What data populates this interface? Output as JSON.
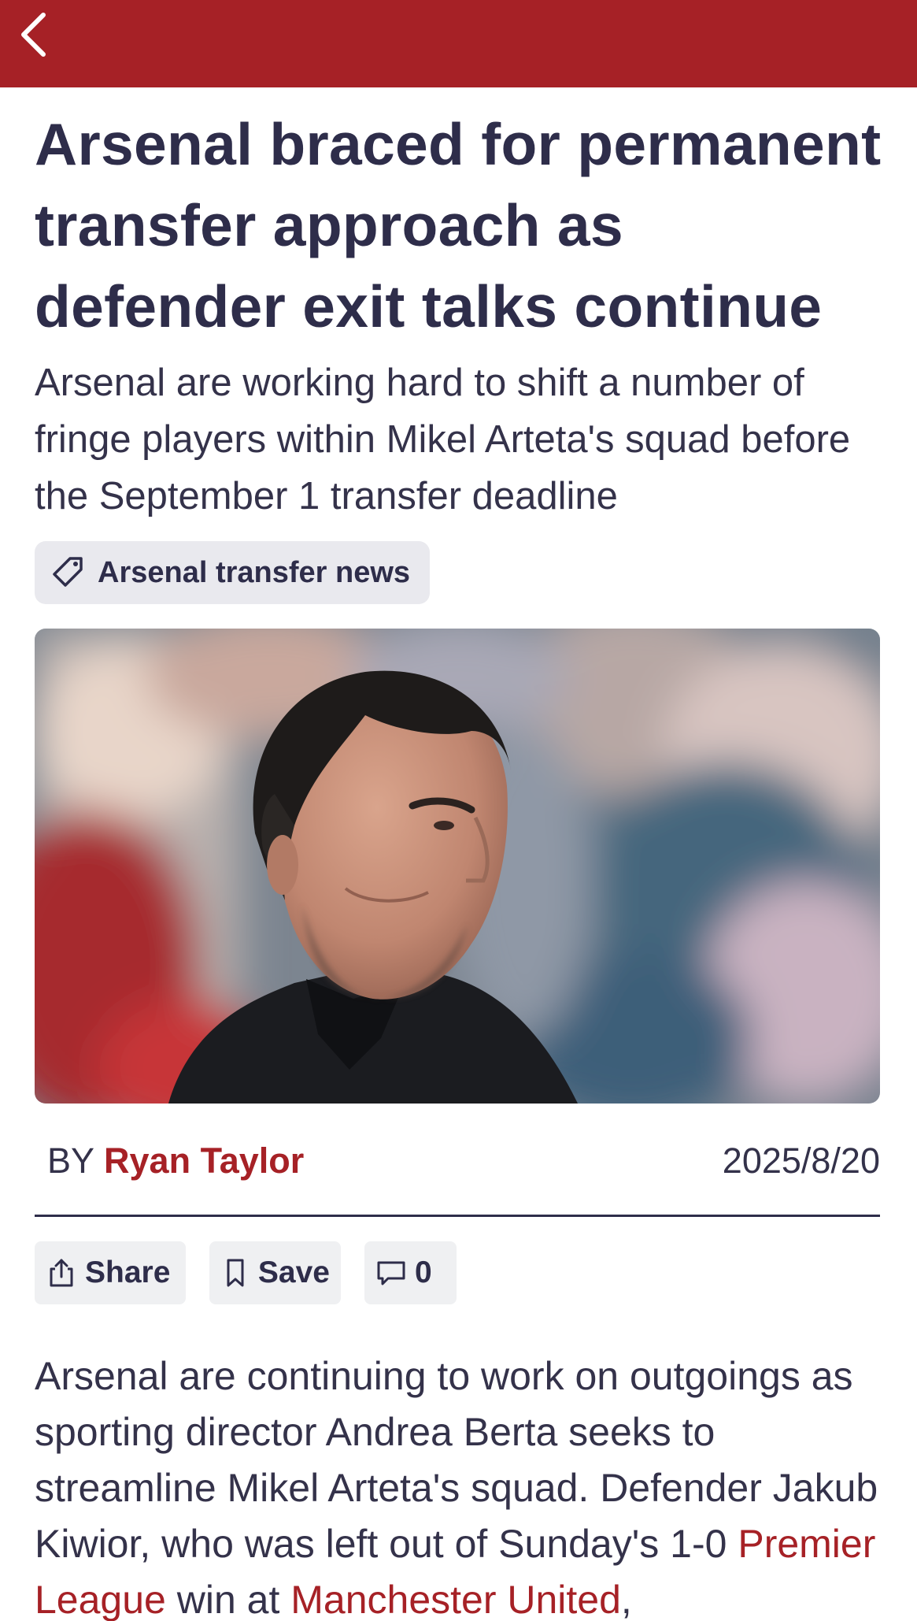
{
  "app": {
    "bar_color": "#a62126",
    "accent_color": "#a62126",
    "text_color": "#2e2d4a"
  },
  "topbar": {
    "back_icon": "chevron-left-icon",
    "title": ""
  },
  "article": {
    "headline": "Arsenal braced for permanent transfer approach as defender exit talks continue",
    "standfirst": "Arsenal are working hard to shift a number of fringe players within Mikel Arteta's squad before the September 1 transfer deadline",
    "tag": {
      "icon": "tag-icon",
      "label": "Arsenal transfer news"
    },
    "hero_image": {
      "subject": "portrait photo, blurred stadium crowd background"
    },
    "byline": {
      "prefix": "BY",
      "author": "Ryan Taylor"
    },
    "date": "2025/8/20",
    "actions": {
      "share": {
        "icon": "share-icon",
        "label": "Share"
      },
      "save": {
        "icon": "bookmark-icon",
        "label": "Save"
      },
      "comments": {
        "icon": "comment-icon",
        "count": "0"
      }
    },
    "body": {
      "text_1": "Arsenal are continuing to work on outgoings as sporting director Andrea Berta seeks to streamline Mikel Arteta's squad. Defender Jakub Kiwior, who was left out of Sunday's 1-0 ",
      "link_1": "Premier League",
      "text_2": " win at ",
      "link_2": "Manchester United",
      "text_3": ","
    }
  }
}
